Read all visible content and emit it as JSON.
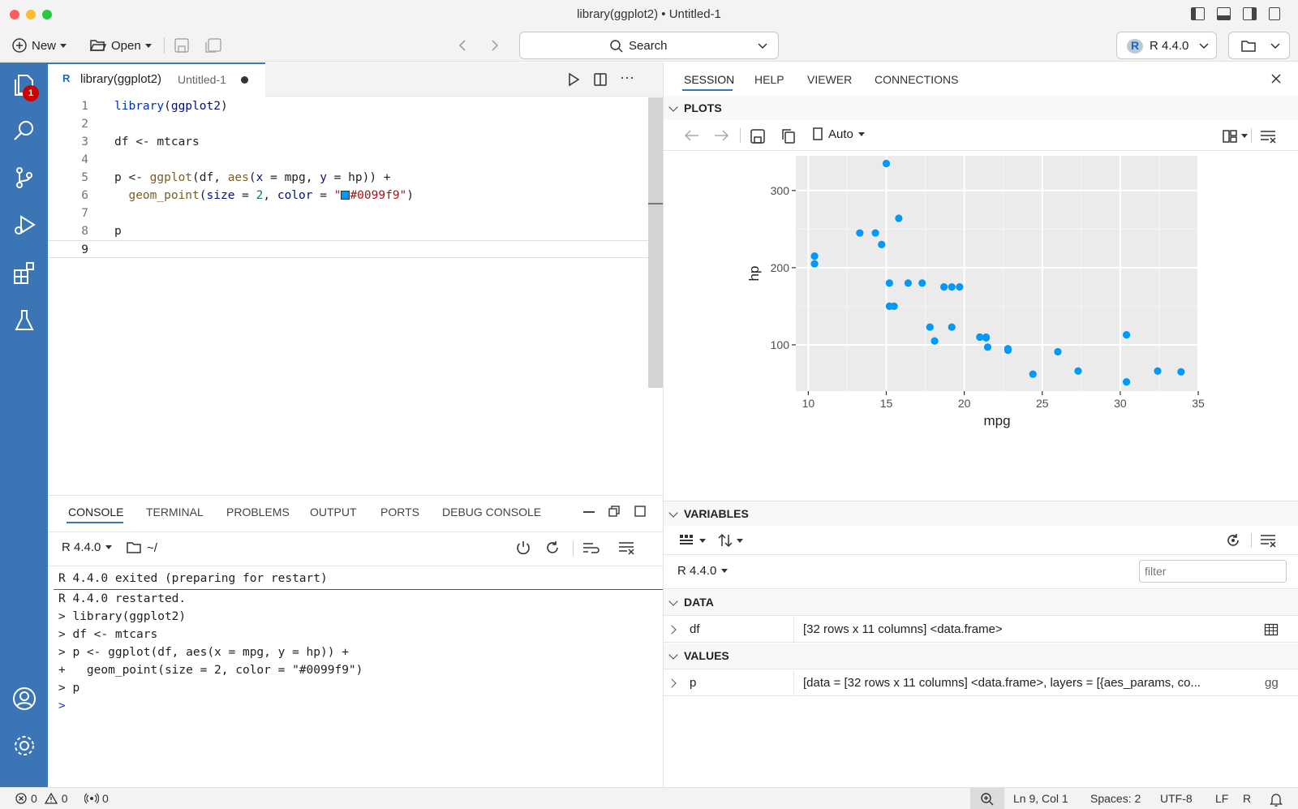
{
  "window": {
    "title": "library(ggplot2) • Untitled-1"
  },
  "toolbar": {
    "new_label": "New",
    "open_label": "Open",
    "search_label": "Search",
    "r_version": "R 4.4.0"
  },
  "activity": {
    "explorer_badge": "1"
  },
  "editor": {
    "tab_title": "library(ggplot2)",
    "tab_subtitle": "Untitled-1",
    "line_numbers": [
      "1",
      "2",
      "3",
      "4",
      "5",
      "6",
      "7",
      "8",
      "9"
    ],
    "lines": [
      "library(ggplot2)",
      "",
      "df <- mtcars",
      "",
      "p <- ggplot(df, aes(x = mpg, y = hp)) +",
      "  geom_point(size = 2, color = \"#0099f9\")",
      "",
      "p",
      ""
    ]
  },
  "panel": {
    "tabs": [
      "CONSOLE",
      "TERMINAL",
      "PROBLEMS",
      "OUTPUT",
      "PORTS",
      "DEBUG CONSOLE"
    ],
    "active_tab": "CONSOLE",
    "r_version": "R 4.4.0",
    "working_dir": "~/",
    "console_lines": [
      "R 4.4.0 exited (preparing for restart)",
      "R 4.4.0 restarted.",
      "> library(ggplot2)",
      "> df <- mtcars",
      "> p <- ggplot(df, aes(x = mpg, y = hp)) +",
      "+   geom_point(size = 2, color = \"#0099f9\")",
      "> p",
      ">"
    ]
  },
  "right_pane": {
    "tabs": [
      "SESSION",
      "HELP",
      "VIEWER",
      "CONNECTIONS"
    ],
    "active_tab": "SESSION",
    "plots_header": "PLOTS",
    "plots_zoom": "Auto",
    "variables_header": "VARIABLES",
    "r_version": "R 4.4.0",
    "filter_placeholder": "filter",
    "data_header": "DATA",
    "values_header": "VALUES",
    "data_rows": [
      {
        "name": "df",
        "value": "[32 rows x 11 columns] <data.frame>"
      }
    ],
    "value_rows": [
      {
        "name": "p",
        "value": "[data = [32 rows x 11 columns] <data.frame>, layers = [{aes_params, co...",
        "type": "gg"
      }
    ]
  },
  "chart_data": {
    "type": "scatter",
    "xlabel": "mpg",
    "ylabel": "hp",
    "xlim": [
      9.2,
      35
    ],
    "ylim": [
      40,
      345
    ],
    "xticks": [
      10,
      15,
      20,
      25,
      30,
      35
    ],
    "yticks": [
      100,
      200,
      300
    ],
    "point_color": "#0099f9",
    "panel_background": "#ebebeb",
    "grid": true,
    "points": [
      [
        21.0,
        110
      ],
      [
        21.0,
        110
      ],
      [
        22.8,
        93
      ],
      [
        21.4,
        110
      ],
      [
        18.7,
        175
      ],
      [
        18.1,
        105
      ],
      [
        14.3,
        245
      ],
      [
        24.4,
        62
      ],
      [
        22.8,
        95
      ],
      [
        19.2,
        123
      ],
      [
        17.8,
        123
      ],
      [
        16.4,
        180
      ],
      [
        17.3,
        180
      ],
      [
        15.2,
        180
      ],
      [
        10.4,
        205
      ],
      [
        10.4,
        215
      ],
      [
        14.7,
        230
      ],
      [
        32.4,
        66
      ],
      [
        30.4,
        52
      ],
      [
        33.9,
        65
      ],
      [
        21.5,
        97
      ],
      [
        15.5,
        150
      ],
      [
        15.2,
        150
      ],
      [
        13.3,
        245
      ],
      [
        19.2,
        175
      ],
      [
        27.3,
        66
      ],
      [
        26.0,
        91
      ],
      [
        30.4,
        113
      ],
      [
        15.8,
        264
      ],
      [
        19.7,
        175
      ],
      [
        15.0,
        335
      ],
      [
        21.4,
        109
      ]
    ]
  },
  "statusbar": {
    "errors": "0",
    "warnings": "0",
    "ports": "0",
    "position": "Ln 9, Col 1",
    "spaces": "Spaces: 2",
    "encoding": "UTF-8",
    "eol": "LF",
    "language": "R"
  },
  "colors": {
    "accent": "#3b75b5",
    "badge": "#cc0000",
    "point": "#0099f9"
  }
}
